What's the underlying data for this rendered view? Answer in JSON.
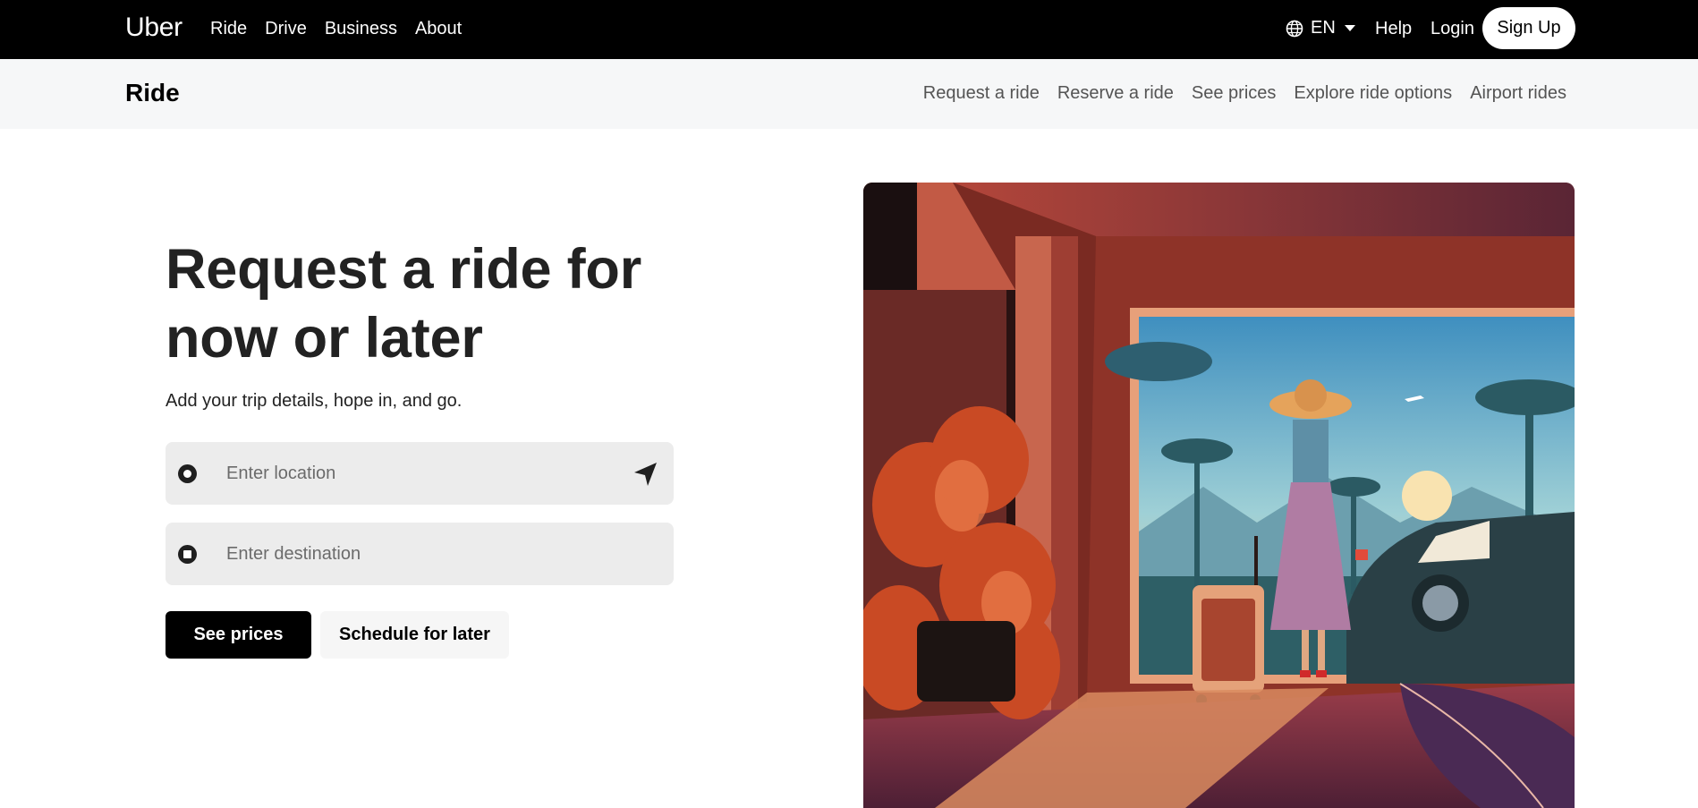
{
  "topnav": {
    "brand": "Uber",
    "links": [
      "Ride",
      "Drive",
      "Business",
      "About"
    ],
    "language": "EN",
    "help": "Help",
    "login": "Login",
    "signup": "Sign Up",
    "icons": {
      "language": "globe-icon",
      "dropdown": "caret-down-icon"
    }
  },
  "subnav": {
    "title": "Ride",
    "links": [
      "Request a ride",
      "Reserve a ride",
      "See prices",
      "Explore ride options",
      "Airport rides"
    ]
  },
  "hero": {
    "headline": "Request a ride for now or later",
    "lede": "Add your trip details, hope in, and go.",
    "pickup": {
      "placeholder": "Enter location",
      "icon": "location-arrow-icon"
    },
    "dropoff": {
      "placeholder": "Enter destination"
    },
    "primary_button": "See prices",
    "secondary_button": "Schedule for later"
  },
  "colors": {
    "topnav_bg": "#000000",
    "subnav_bg": "#f6f7f8",
    "field_bg": "#ececec",
    "primary": "#000000"
  }
}
